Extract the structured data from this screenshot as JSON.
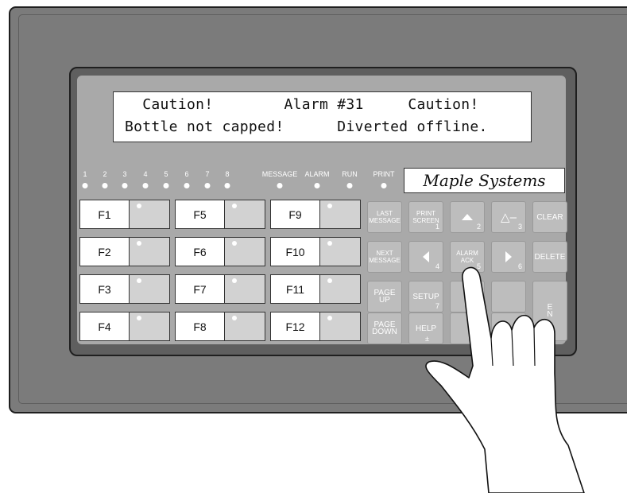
{
  "lcd": {
    "line1": "  Caution!        Alarm #31     Caution!",
    "line2": "Bottle not capped!      Diverted offline."
  },
  "indicators": {
    "numbers": [
      "1",
      "2",
      "3",
      "4",
      "5",
      "6",
      "7",
      "8"
    ],
    "message": "MESSAGE",
    "alarm": "ALARM",
    "run": "RUN",
    "print": "PRINT"
  },
  "brand": "Maple Systems",
  "function_keys": [
    "F1",
    "F2",
    "F3",
    "F4",
    "F5",
    "F6",
    "F7",
    "F8",
    "F9",
    "F10",
    "F11",
    "F12"
  ],
  "keypad": {
    "last_message": [
      "LAST",
      "MESSAGE"
    ],
    "print_screen": [
      "PRINT",
      "SCREEN"
    ],
    "print_screen_num": "1",
    "up_num": "2",
    "triangle_minus": "△–",
    "triangle_minus_num": "3",
    "clear": "CLEAR",
    "next_message": [
      "NEXT",
      "MESSAGE"
    ],
    "left_num": "4",
    "alarm_ack": [
      "ALARM",
      "ACK"
    ],
    "alarm_ack_num": "5",
    "right_num": "6",
    "delete": "DELETE",
    "page_up": [
      "PAGE",
      "UP"
    ],
    "setup": "SETUP",
    "setup_num": "7",
    "enter": [
      "E",
      "N"
    ],
    "page_down": [
      "PAGE",
      "DOWN"
    ],
    "help": "HELP",
    "help_sym": "±"
  },
  "colors": {
    "bezel": "#7b7b7b",
    "panel": "#5f5f5f",
    "face": "#a9a9a9",
    "key": "#bdbdbd",
    "led": "#ffffff"
  }
}
